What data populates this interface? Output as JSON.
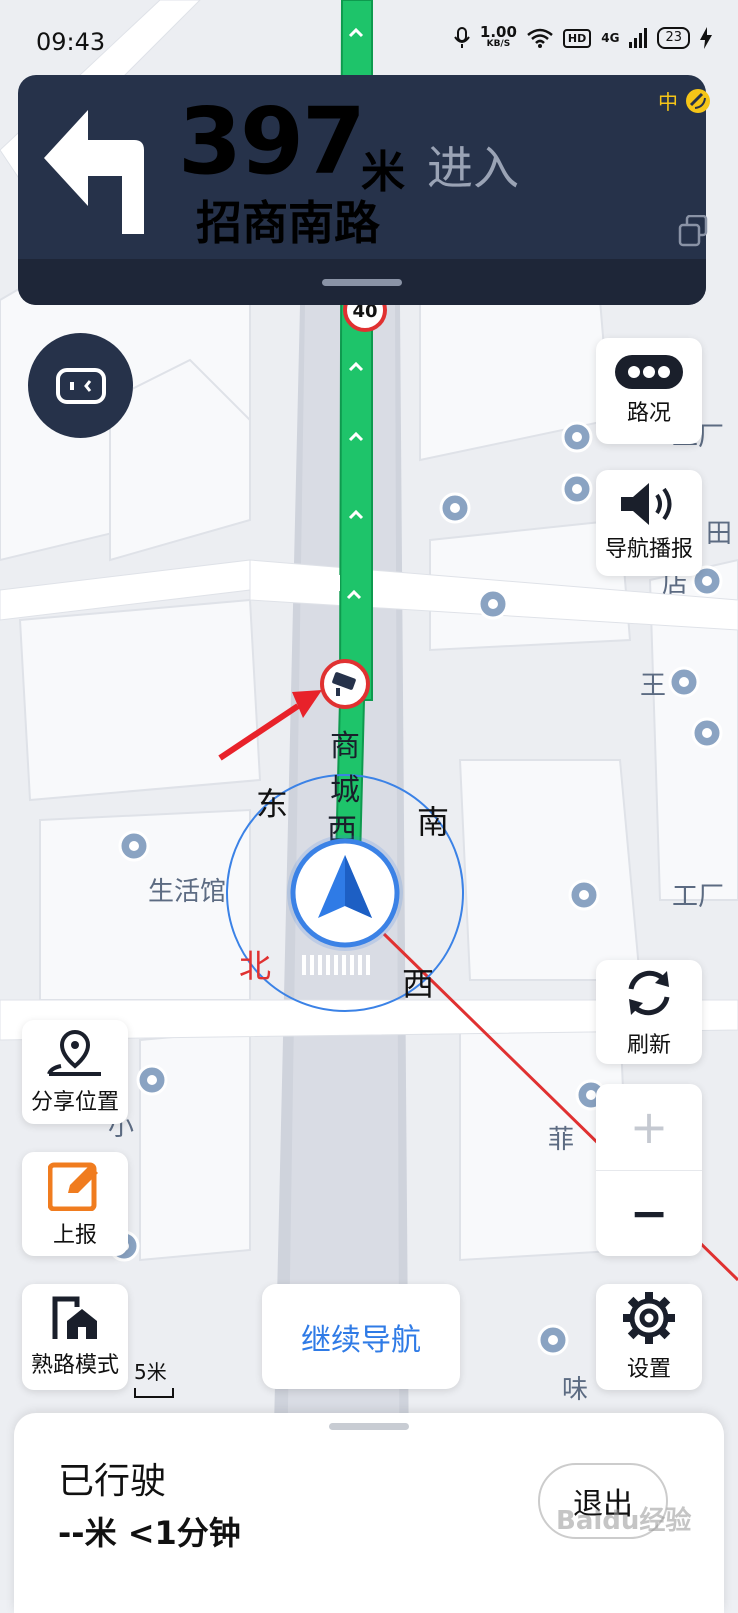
{
  "status_bar": {
    "time": "09:43",
    "net_speed": "1.00",
    "net_unit": "KB/S",
    "hd": "HD",
    "signal": "4G",
    "battery": "23"
  },
  "banner": {
    "distance": "397",
    "unit": "米",
    "action": "进入",
    "road": "招商南路",
    "gps_strength": "中"
  },
  "map": {
    "speed_limit": "40",
    "road_label": [
      "商",
      "城",
      "西"
    ],
    "compass": {
      "east": "东",
      "south": "南",
      "north": "北",
      "west": "西"
    },
    "pois": [
      "生活馆",
      "工厂",
      "工厂",
      "店",
      "王",
      "菲",
      "味",
      "小",
      "田"
    ],
    "scale": "5米"
  },
  "right_buttons": {
    "traffic": "路况",
    "voice": "导航播报",
    "refresh": "刷新",
    "zoom_in": "+",
    "zoom_out": "−",
    "settings": "设置"
  },
  "left_buttons": {
    "share": "分享位置",
    "report": "上报",
    "familiar": "熟路模式"
  },
  "continue_nav": "继续导航",
  "bottom": {
    "driven_label": "已行驶",
    "driven_stats": "--米 <1分钟",
    "exit": "退出"
  },
  "watermark": "Baidu经验",
  "colors": {
    "route": "#1ec46a",
    "banner": "#26324a",
    "accent": "#2f7be6",
    "north": "#e03131"
  }
}
